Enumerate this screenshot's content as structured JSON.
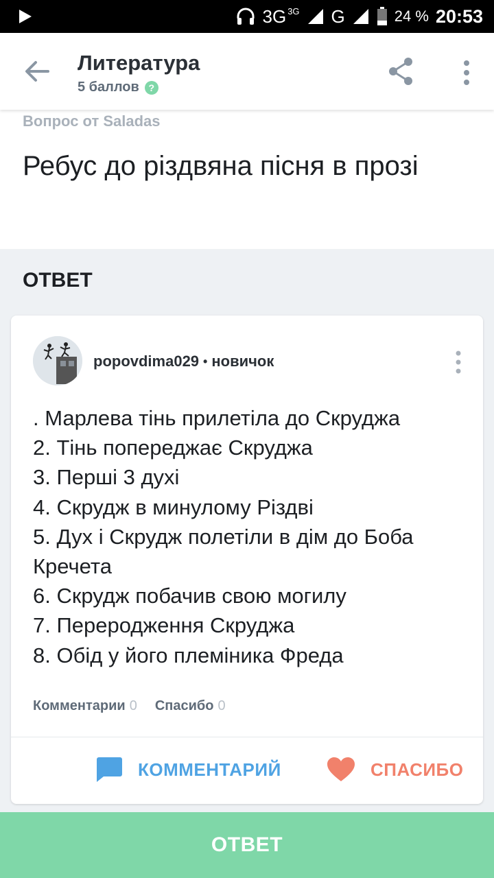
{
  "statusbar": {
    "network_3g": "3G",
    "network_3g_sup": "3G",
    "network_g": "G",
    "battery": "24 %",
    "time": "20:53"
  },
  "appbar": {
    "title": "Литература",
    "points": "5 баллов"
  },
  "question": {
    "asker": "Вопрос от Saladas",
    "text": "Ребус до різдвяна пісня в прозі"
  },
  "answer_heading": "ОТВЕТ",
  "answer": {
    "username": "popovdima029",
    "separator": "•",
    "rank": "новичок",
    "lines": [
      ". Марлева тінь прилетіла до Скруджа",
      "2. Тінь попереджає Скруджа",
      "3. Перші 3 духі",
      "4. Скрудж в минулому Різдві",
      "5. Дух і Скрудж полетіли в дім до Боба Кречета",
      "6. Скрудж побачив свою могилу",
      "7. Переродження Скруджа",
      "8. Обід у його племіника Фреда"
    ],
    "comments_label": "Комментарии",
    "comments_count": "0",
    "thanks_label": "Спасибо",
    "thanks_count": "0",
    "comment_button": "КОММЕНТАРИЙ",
    "thanks_button": "СПАСИБО"
  },
  "bottom_button": "ОТВЕТ",
  "colors": {
    "accent_green": "#7fd7a8",
    "comment_blue": "#4fa3e3",
    "thanks_red": "#f1816b"
  }
}
